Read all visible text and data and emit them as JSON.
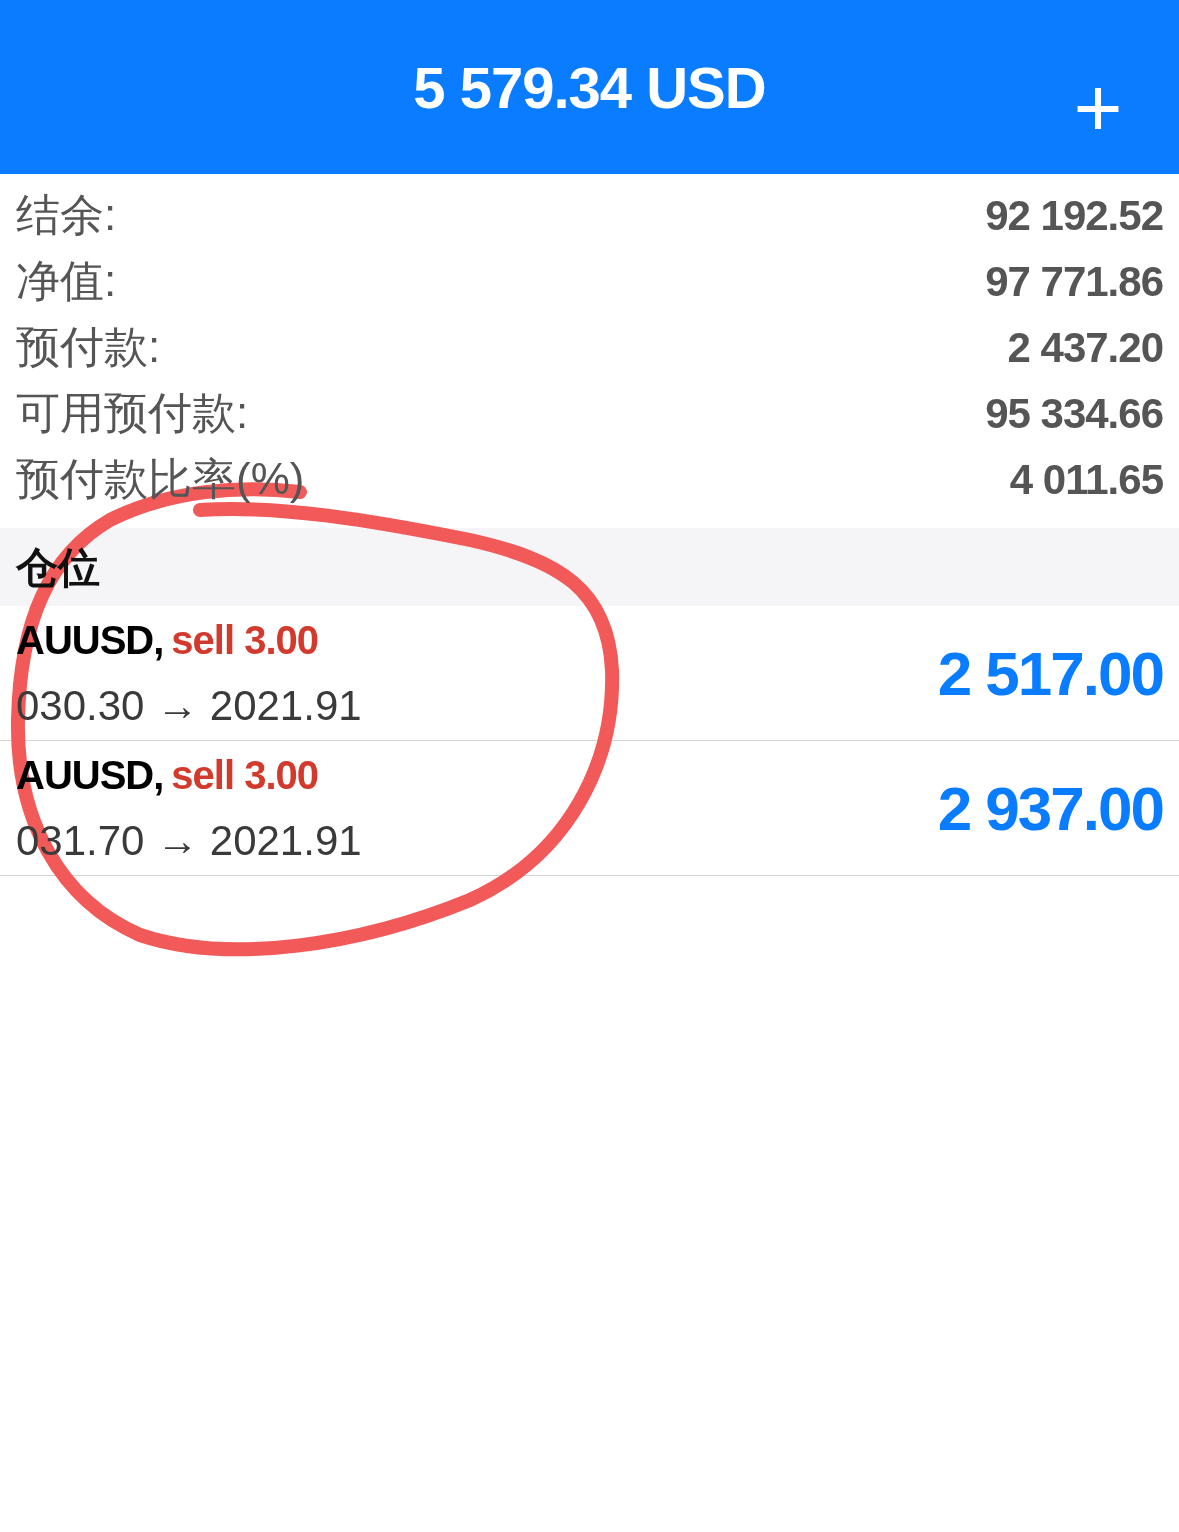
{
  "header": {
    "title": "5 579.34 USD",
    "action": "+"
  },
  "summary": [
    {
      "label": "结余:",
      "value": "92 192.52"
    },
    {
      "label": "净值:",
      "value": "97 771.86"
    },
    {
      "label": "预付款:",
      "value": "2 437.20"
    },
    {
      "label": "可用预付款:",
      "value": "95 334.66"
    },
    {
      "label": "预付款比率(%)",
      "value": "4 011.65"
    }
  ],
  "positions_section": {
    "title": "仓位"
  },
  "positions": [
    {
      "symbol": "AUUSD,",
      "order": "sell 3.00",
      "prices": "030.30 → 2021.91",
      "profit": "2 517.00"
    },
    {
      "symbol": "AUUSD,",
      "order": "sell 3.00",
      "prices": "031.70 → 2021.91",
      "profit": "2 937.00"
    }
  ]
}
